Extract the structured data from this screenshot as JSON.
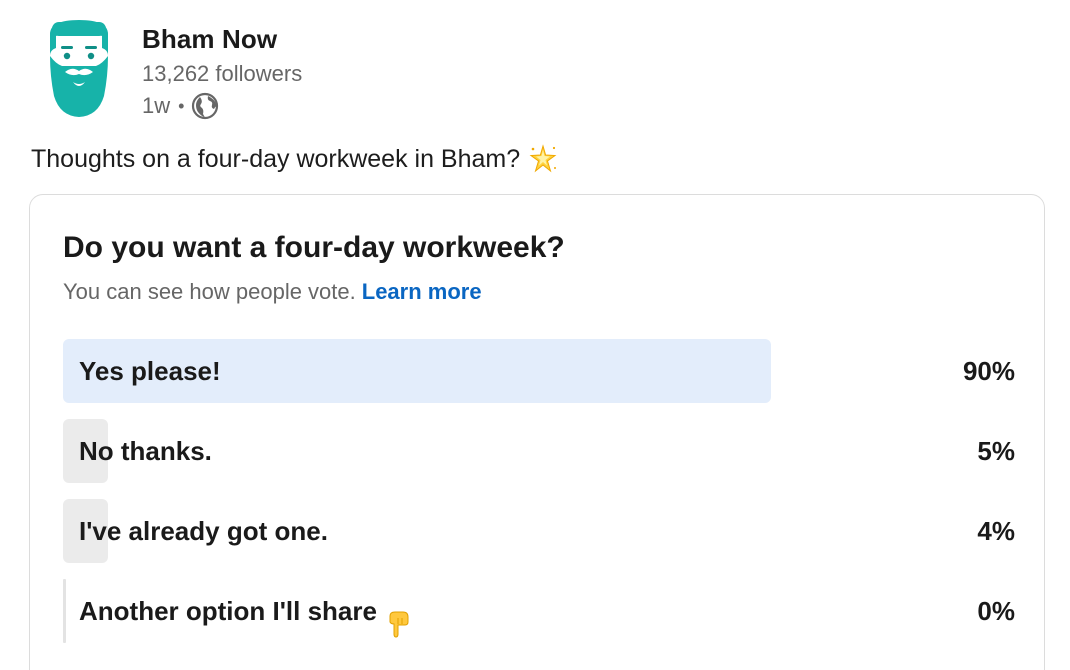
{
  "author": {
    "name": "Bham Now",
    "followers": "13,262 followers",
    "age": "1w",
    "separator": "•",
    "visibility_icon": "globe-icon",
    "avatar_icon": "bearded-man-logo",
    "brand_color": "#17b3a9"
  },
  "post": {
    "text": "Thoughts on a four-day workweek in Bham?",
    "emoji_icon": "sparkle-star-icon"
  },
  "poll": {
    "question": "Do you want a four-day workweek?",
    "subtitle": "You can see how people vote.",
    "learn_more": "Learn more",
    "options": [
      {
        "label": "Yes please!",
        "percent_label": "90%",
        "fraction": 0.9,
        "selected": true
      },
      {
        "label": "No thanks.",
        "percent_label": "5%",
        "fraction": 0.05,
        "selected": false
      },
      {
        "label": "I've already got one.",
        "percent_label": "4%",
        "fraction": 0.04,
        "selected": false
      },
      {
        "label": "Another option I'll share",
        "percent_label": "0%",
        "fraction": 0.0,
        "selected": false,
        "emoji_icon": "pointing-down-hand-icon"
      }
    ]
  },
  "colors": {
    "selected_fill": "#e3edfb",
    "other_fill": "#ebebeb",
    "link": "#0a66c2",
    "muted_text": "#666666"
  }
}
